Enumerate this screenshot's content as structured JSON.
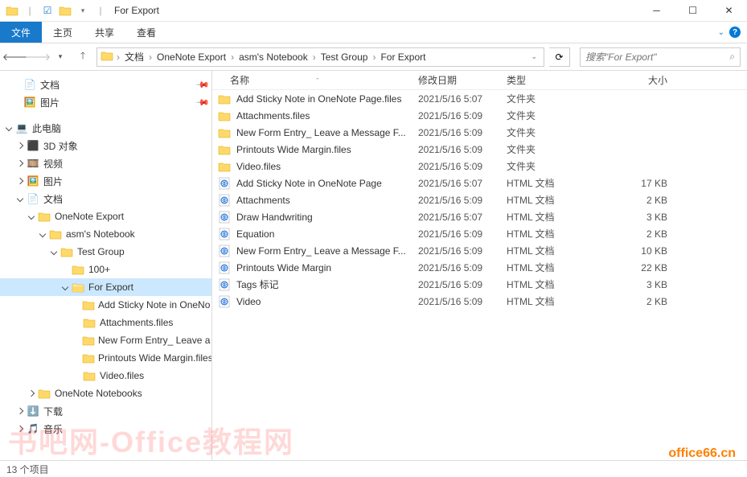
{
  "window": {
    "title": "For Export"
  },
  "ribbon": {
    "file": "文件",
    "home": "主页",
    "share": "共享",
    "view": "查看"
  },
  "breadcrumb": {
    "items": [
      "文档",
      "OneNote Export",
      "asm's Notebook",
      "Test Group",
      "For Export"
    ]
  },
  "search": {
    "placeholder": "搜索\"For Export\""
  },
  "columns": {
    "name": "名称",
    "date": "修改日期",
    "type": "类型",
    "size": "大小"
  },
  "tree": {
    "quick": [
      {
        "label": "文档",
        "icon": "doc",
        "pinned": true
      },
      {
        "label": "图片",
        "icon": "pic",
        "pinned": true
      }
    ],
    "pc_label": "此电脑",
    "pc": [
      {
        "label": "3D 对象",
        "icon": "3d"
      },
      {
        "label": "视频",
        "icon": "video"
      },
      {
        "label": "图片",
        "icon": "pic"
      },
      {
        "label": "文档",
        "icon": "doc",
        "expanded": true
      }
    ],
    "onenote_export": "OneNote Export",
    "notebook": "asm's Notebook",
    "testgroup": "Test Group",
    "hundred": "100+",
    "forexport": "For Export",
    "subfolders": [
      "Add Sticky Note in OneNo",
      "Attachments.files",
      "New Form Entry_ Leave a M",
      "Printouts Wide Margin.files",
      "Video.files"
    ],
    "onenote_notebooks": "OneNote Notebooks",
    "downloads": "下载",
    "music": "音乐"
  },
  "files": [
    {
      "name": "Add Sticky Note in OneNote Page.files",
      "date": "2021/5/16 5:07",
      "type": "文件夹",
      "size": "",
      "icon": "folder"
    },
    {
      "name": "Attachments.files",
      "date": "2021/5/16 5:09",
      "type": "文件夹",
      "size": "",
      "icon": "folder"
    },
    {
      "name": "New Form Entry_ Leave a Message F...",
      "date": "2021/5/16 5:09",
      "type": "文件夹",
      "size": "",
      "icon": "folder"
    },
    {
      "name": "Printouts Wide Margin.files",
      "date": "2021/5/16 5:09",
      "type": "文件夹",
      "size": "",
      "icon": "folder"
    },
    {
      "name": "Video.files",
      "date": "2021/5/16 5:09",
      "type": "文件夹",
      "size": "",
      "icon": "folder"
    },
    {
      "name": "Add Sticky Note in OneNote Page",
      "date": "2021/5/16 5:07",
      "type": "HTML 文档",
      "size": "17 KB",
      "icon": "html"
    },
    {
      "name": "Attachments",
      "date": "2021/5/16 5:09",
      "type": "HTML 文档",
      "size": "2 KB",
      "icon": "html"
    },
    {
      "name": "Draw Handwriting",
      "date": "2021/5/16 5:07",
      "type": "HTML 文档",
      "size": "3 KB",
      "icon": "html"
    },
    {
      "name": "Equation",
      "date": "2021/5/16 5:09",
      "type": "HTML 文档",
      "size": "2 KB",
      "icon": "html"
    },
    {
      "name": "New Form Entry_ Leave a Message F...",
      "date": "2021/5/16 5:09",
      "type": "HTML 文档",
      "size": "10 KB",
      "icon": "html"
    },
    {
      "name": "Printouts Wide Margin",
      "date": "2021/5/16 5:09",
      "type": "HTML 文档",
      "size": "22 KB",
      "icon": "html"
    },
    {
      "name": "Tags 标记",
      "date": "2021/5/16 5:09",
      "type": "HTML 文档",
      "size": "3 KB",
      "icon": "html"
    },
    {
      "name": "Video",
      "date": "2021/5/16 5:09",
      "type": "HTML 文档",
      "size": "2 KB",
      "icon": "html"
    }
  ],
  "status": {
    "count": "13 个项目"
  },
  "watermark": "office66.cn",
  "watermark2": "书吧网-Office教程网"
}
